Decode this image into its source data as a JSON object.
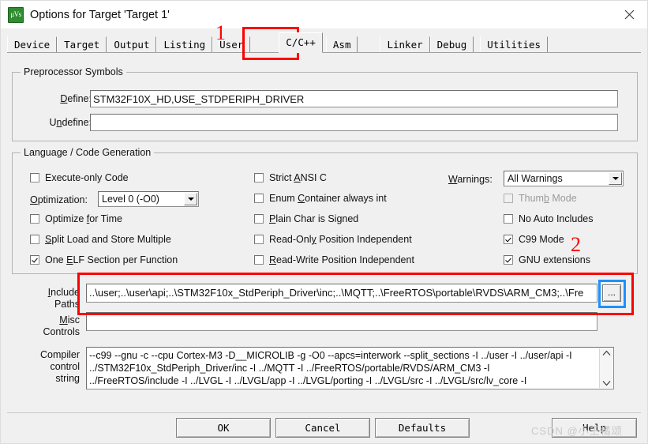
{
  "window": {
    "title": "Options for Target 'Target 1'",
    "app_icon": "keil-uvision-icon",
    "close_icon": "close-icon"
  },
  "tabs": [
    {
      "label": "Device",
      "active": false
    },
    {
      "label": "Target",
      "active": false
    },
    {
      "label": "Output",
      "active": false
    },
    {
      "label": "Listing",
      "active": false
    },
    {
      "label": "User",
      "active": false
    },
    {
      "label": "C/C++",
      "active": true
    },
    {
      "label": "Asm",
      "active": false
    },
    {
      "label": "Linker",
      "active": false
    },
    {
      "label": "Debug",
      "active": false
    },
    {
      "label": "Utilities",
      "active": false
    }
  ],
  "preprocessor": {
    "legend": "Preprocessor Symbols",
    "define_label": "Define:",
    "define_value": "STM32F10X_HD,USE_STDPERIPH_DRIVER",
    "undefine_label": "Undefine:",
    "undefine_value": ""
  },
  "language": {
    "legend": "Language / Code Generation",
    "left_column": [
      {
        "label": "Execute-only Code",
        "checked": false,
        "disabled": false
      },
      {
        "label": "Optimize for Time",
        "checked": false,
        "disabled": false
      },
      {
        "label": "Split Load and Store Multiple",
        "checked": false,
        "disabled": false
      },
      {
        "label": "One ELF Section per Function",
        "checked": true,
        "disabled": false
      }
    ],
    "optimization_label": "Optimization:",
    "optimization_value": "Level 0 (-O0)",
    "middle_column": [
      {
        "label": "Strict ANSI C",
        "checked": false,
        "disabled": false
      },
      {
        "label": "Enum Container always int",
        "checked": false,
        "disabled": false
      },
      {
        "label": "Plain Char is Signed",
        "checked": false,
        "disabled": false
      },
      {
        "label": "Read-Only Position Independent",
        "checked": false,
        "disabled": false
      },
      {
        "label": "Read-Write Position Independent",
        "checked": false,
        "disabled": false
      }
    ],
    "warnings_label": "Warnings:",
    "warnings_value": "All Warnings",
    "right_column": [
      {
        "label": "Thumb Mode",
        "checked": false,
        "disabled": true
      },
      {
        "label": "No Auto Includes",
        "checked": false,
        "disabled": false
      },
      {
        "label": "C99 Mode",
        "checked": true,
        "disabled": false
      },
      {
        "label": "GNU extensions",
        "checked": true,
        "disabled": false
      }
    ]
  },
  "paths": {
    "include_label_line1": "Include",
    "include_label_line2": "Paths",
    "include_value": "..\\user;..\\user\\api;..\\STM32F10x_StdPeriph_Driver\\inc;..\\MQTT;..\\FreeRTOS\\portable\\RVDS\\ARM_CM3;..\\Fre",
    "browse_label": "...",
    "misc_label_line1": "Misc",
    "misc_label_line2": "Controls",
    "misc_value": "",
    "compiler_label_line1": "Compiler",
    "compiler_label_line2": "control",
    "compiler_label_line3": "string",
    "compiler_lines": [
      "--c99 --gnu -c --cpu Cortex-M3 -D__MICROLIB -g -O0 --apcs=interwork --split_sections -I ../user -I ../user/api -I",
      "../STM32F10x_StdPeriph_Driver/inc -I ../MQTT -I ../FreeRTOS/portable/RVDS/ARM_CM3 -I",
      "../FreeRTOS/include -I ../LVGL -I ../LVGL/app -I ../LVGL/porting -I ../LVGL/src -I ../LVGL/src/lv_core -I"
    ],
    "scroll_up_icon": "chevron-up-icon",
    "scroll_down_icon": "chevron-down-icon"
  },
  "footer": {
    "ok_label": "OK",
    "cancel_label": "Cancel",
    "defaults_label": "Defaults",
    "help_label": "Help"
  },
  "annotations": {
    "marker_1": "1",
    "marker_2": "2"
  },
  "watermark": "CSDN @小王橘颂",
  "colors": {
    "annotation_red": "#fe0000",
    "annotation_blue": "#1e90ff",
    "dialog_bg": "#f0f0f0",
    "field_bg": "#ffffff"
  }
}
